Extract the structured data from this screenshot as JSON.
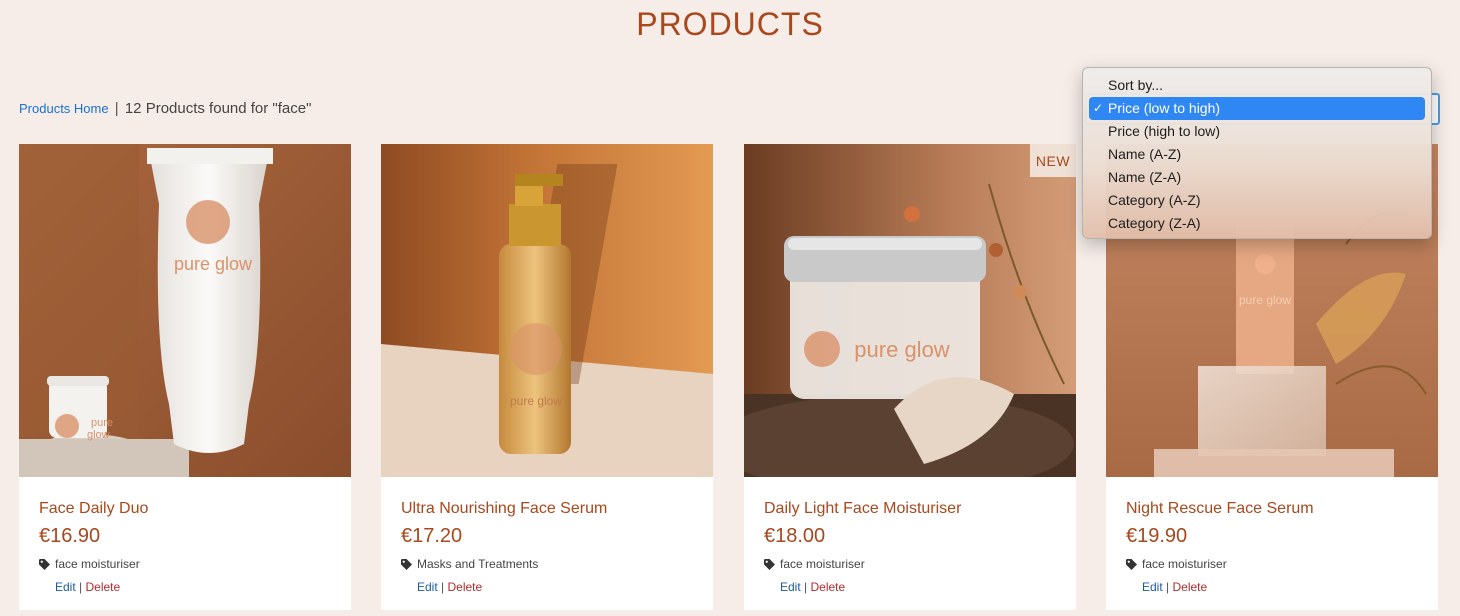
{
  "page": {
    "title": "PRODUCTS"
  },
  "breadcrumb": {
    "home": "Products Home",
    "separator": "|",
    "results": "12 Products found for \"face\""
  },
  "sort": {
    "options": [
      {
        "label": "Sort by...",
        "selected": false
      },
      {
        "label": "Price (low to high)",
        "selected": true
      },
      {
        "label": "Price (high to low)",
        "selected": false
      },
      {
        "label": "Name (A-Z)",
        "selected": false
      },
      {
        "label": "Name (Z-A)",
        "selected": false
      },
      {
        "label": "Category (A-Z)",
        "selected": false
      },
      {
        "label": "Category (Z-A)",
        "selected": false
      }
    ],
    "check_mark": "✓"
  },
  "products": [
    {
      "name": "Face Daily Duo",
      "price": "€16.90",
      "category": "face moisturiser",
      "edit": "Edit",
      "delete": "Delete",
      "image_text": "pure glow",
      "image_text_small": "pure glow"
    },
    {
      "name": "Ultra Nourishing Face Serum",
      "price": "€17.20",
      "category": "Masks and Treatments",
      "edit": "Edit",
      "delete": "Delete",
      "image_text": "pure glow"
    },
    {
      "name": "Daily Light Face Moisturiser",
      "price": "€18.00",
      "category": "face moisturiser",
      "edit": "Edit",
      "delete": "Delete",
      "badge": "NEW",
      "image_text": "pure glow"
    },
    {
      "name": "Night Rescue Face Serum",
      "price": "€19.90",
      "category": "face moisturiser",
      "edit": "Edit",
      "delete": "Delete",
      "image_text": "pure glow"
    }
  ],
  "colors": {
    "background": "#f6ede8",
    "accent": "#a8481c",
    "link": "#1a6fd1",
    "delete": "#b02a2a",
    "selected_option": "#2f87f3"
  }
}
